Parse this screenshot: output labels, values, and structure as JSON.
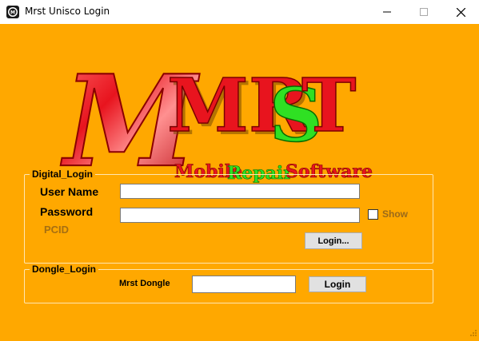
{
  "window": {
    "title": "Mrst Unisco Login",
    "icon": "mrst-app-icon",
    "controls": [
      "minimize-icon",
      "maximize-icon",
      "close-icon"
    ]
  },
  "logo": {
    "big_letter": "M",
    "wordmark_red": "MR",
    "wordmark_green": "S",
    "wordmark_end": "T",
    "tagline_a": "Mobile",
    "tagline_b": "Repair",
    "tagline_c": "Software"
  },
  "digital_login": {
    "legend": "Digital_Login",
    "username_label": "User Name",
    "username_value": "",
    "password_label": "Password",
    "password_value": "",
    "show_label": "Show",
    "show_checked": false,
    "pcid_label": "PCID",
    "login_button": "Login..."
  },
  "dongle_login": {
    "legend": "Dongle_Login",
    "dongle_label": "Mrst Dongle",
    "dongle_value": "",
    "login_button": "Login"
  },
  "colors": {
    "background": "#ffa800",
    "logo_red": "#e8141e",
    "logo_green": "#2fe023",
    "tagline_yellow": "#f2e600"
  }
}
